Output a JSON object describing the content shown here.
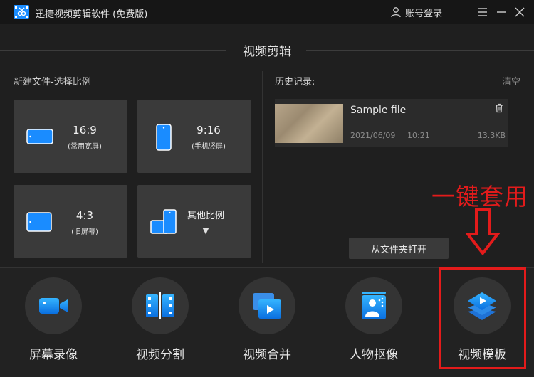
{
  "window": {
    "title": "迅捷视频剪辑软件 (免费版)"
  },
  "header": {
    "account_label": "账号登录"
  },
  "section_title": "视频剪辑",
  "new_file": {
    "label": "新建文件-选择比例",
    "ratios": [
      {
        "ratio": "16:9",
        "desc": "(常用宽屏)"
      },
      {
        "ratio": "9:16",
        "desc": "(手机竖屏)"
      },
      {
        "ratio": "4:3",
        "desc": "(旧屏幕)"
      },
      {
        "ratio": "其他比例",
        "desc": "▼"
      }
    ]
  },
  "history": {
    "label": "历史记录:",
    "clear_label": "清空",
    "items": [
      {
        "name": "Sample file",
        "date": "2021/06/09",
        "time": "10:21",
        "size": "13.3KB"
      }
    ],
    "open_folder_label": "从文件夹打开"
  },
  "annotation": {
    "text": "一键套用",
    "color": "#e31b1b"
  },
  "tools": [
    {
      "label": "屏幕录像",
      "icon": "camera-icon"
    },
    {
      "label": "视频分割",
      "icon": "film-split-icon"
    },
    {
      "label": "视频合并",
      "icon": "video-merge-icon"
    },
    {
      "label": "人物抠像",
      "icon": "portrait-cutout-icon"
    },
    {
      "label": "视频模板",
      "icon": "layers-template-icon"
    }
  ],
  "colors": {
    "accent": "#1a8cff",
    "annotation": "#e31b1b",
    "background": "#1f1f1f"
  }
}
